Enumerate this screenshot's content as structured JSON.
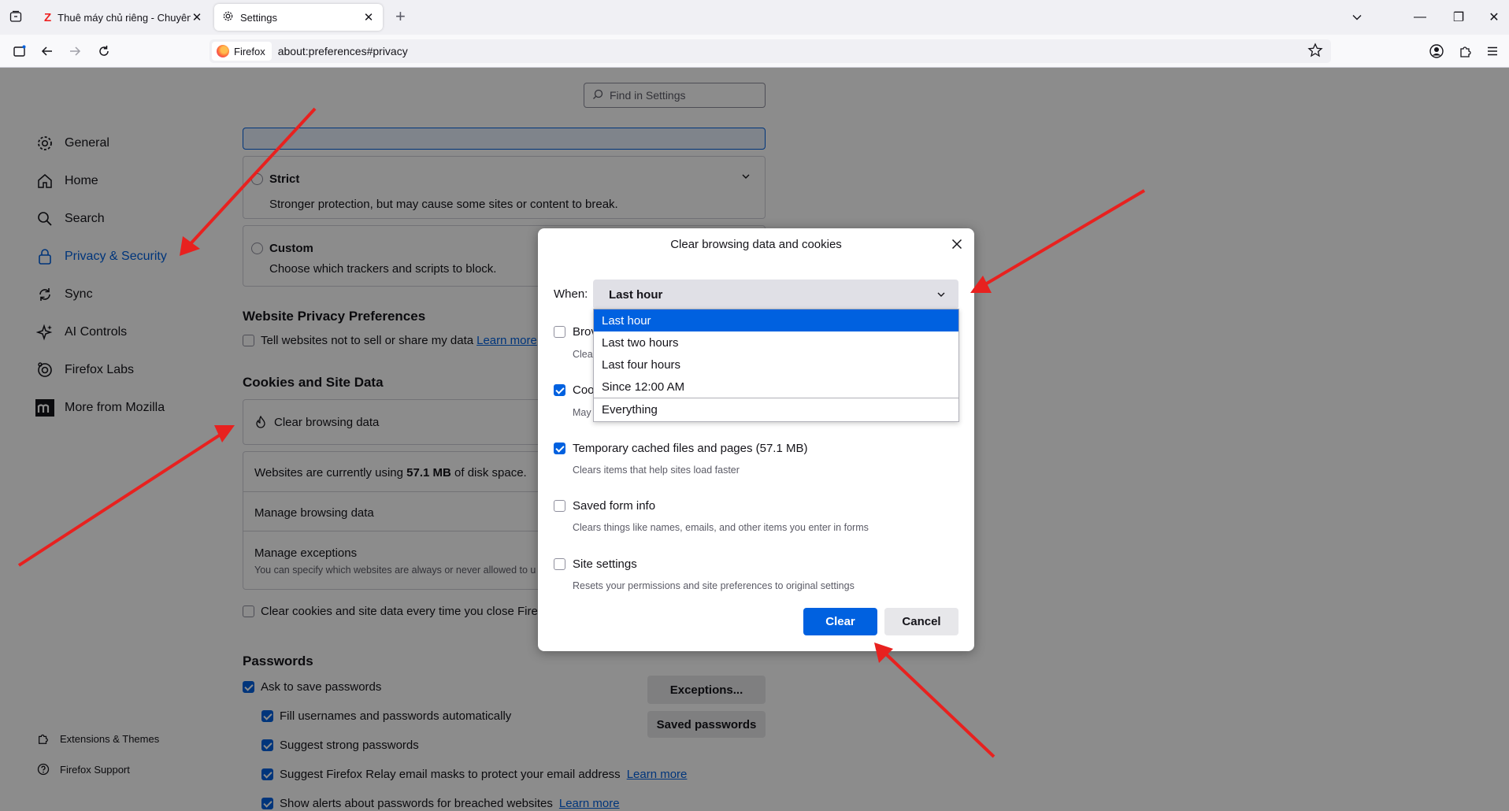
{
  "tabs": [
    {
      "title": "Thuê máy chủ riêng - Chuyên c",
      "close": "✕"
    },
    {
      "title": "Settings",
      "close": "✕"
    }
  ],
  "window_controls": {
    "minimize": "—",
    "restore": "❐",
    "close": "✕"
  },
  "urlbar": {
    "identity": "Firefox",
    "url": "about:preferences#privacy"
  },
  "search": {
    "placeholder": "Find in Settings"
  },
  "sidebar": {
    "items": [
      {
        "label": "General",
        "icon": "gear-icon"
      },
      {
        "label": "Home",
        "icon": "home-icon"
      },
      {
        "label": "Search",
        "icon": "search-icon"
      },
      {
        "label": "Privacy & Security",
        "icon": "lock-icon",
        "selected": true
      },
      {
        "label": "Sync",
        "icon": "sync-icon"
      },
      {
        "label": "AI Controls",
        "icon": "sparkle-icon"
      },
      {
        "label": "Firefox Labs",
        "icon": "flask-icon"
      },
      {
        "label": "More from Mozilla",
        "icon": "mozilla-icon"
      }
    ],
    "extensions": "Extensions & Themes",
    "support": "Firefox Support"
  },
  "tracking": {
    "strict_title": "Strict",
    "strict_desc": "Stronger protection, but may cause some sites or content to break.",
    "custom_title": "Custom",
    "custom_desc": "Choose which trackers and scripts to block."
  },
  "website_privacy": {
    "heading": "Website Privacy Preferences",
    "tell_label": "Tell websites not to sell or share my data",
    "learn_more": "Learn more"
  },
  "cookies": {
    "heading": "Cookies and Site Data",
    "clear_browsing": "Clear browsing data",
    "usage_prefix": "Websites are currently using ",
    "usage_value": "57.1 MB",
    "usage_suffix": " of disk space.",
    "manage_browsing": "Manage browsing data",
    "manage_exceptions": "Manage exceptions",
    "exceptions_desc": "You can specify which websites are always or never allowed to u",
    "clear_on_close": "Clear cookies and site data every time you close Firefo"
  },
  "passwords": {
    "heading": "Passwords",
    "ask_save": "Ask to save passwords",
    "fill": "Fill usernames and passwords automatically",
    "suggest": "Suggest strong passwords",
    "relay": "Suggest Firefox Relay email masks to protect your email address",
    "alerts": "Show alerts about passwords for breached websites",
    "learn_more": "Learn more",
    "exceptions_btn": "Exceptions...",
    "saved_btn": "Saved passwords"
  },
  "dialog": {
    "title": "Clear browsing data and cookies",
    "when_label": "When:",
    "when_value": "Last hour",
    "dropdown_options": [
      "Last hour",
      "Last two hours",
      "Last four hours",
      "Since 12:00 AM",
      "Everything"
    ],
    "options": [
      {
        "label": "Brov",
        "desc": "Clea",
        "checked": false
      },
      {
        "label": "Coo",
        "desc": "May",
        "checked": true
      },
      {
        "label": "Temporary cached files and pages (57.1 MB)",
        "desc": "Clears items that help sites load faster",
        "checked": true
      },
      {
        "label": "Saved form info",
        "desc": "Clears things like names, emails, and other items you enter in forms",
        "checked": false
      },
      {
        "label": "Site settings",
        "desc": "Resets your permissions and site preferences to original settings",
        "checked": false
      }
    ],
    "clear_btn": "Clear",
    "cancel_btn": "Cancel"
  },
  "colors": {
    "accent": "#0061e0",
    "annotation_arrow": "#e8211f"
  }
}
